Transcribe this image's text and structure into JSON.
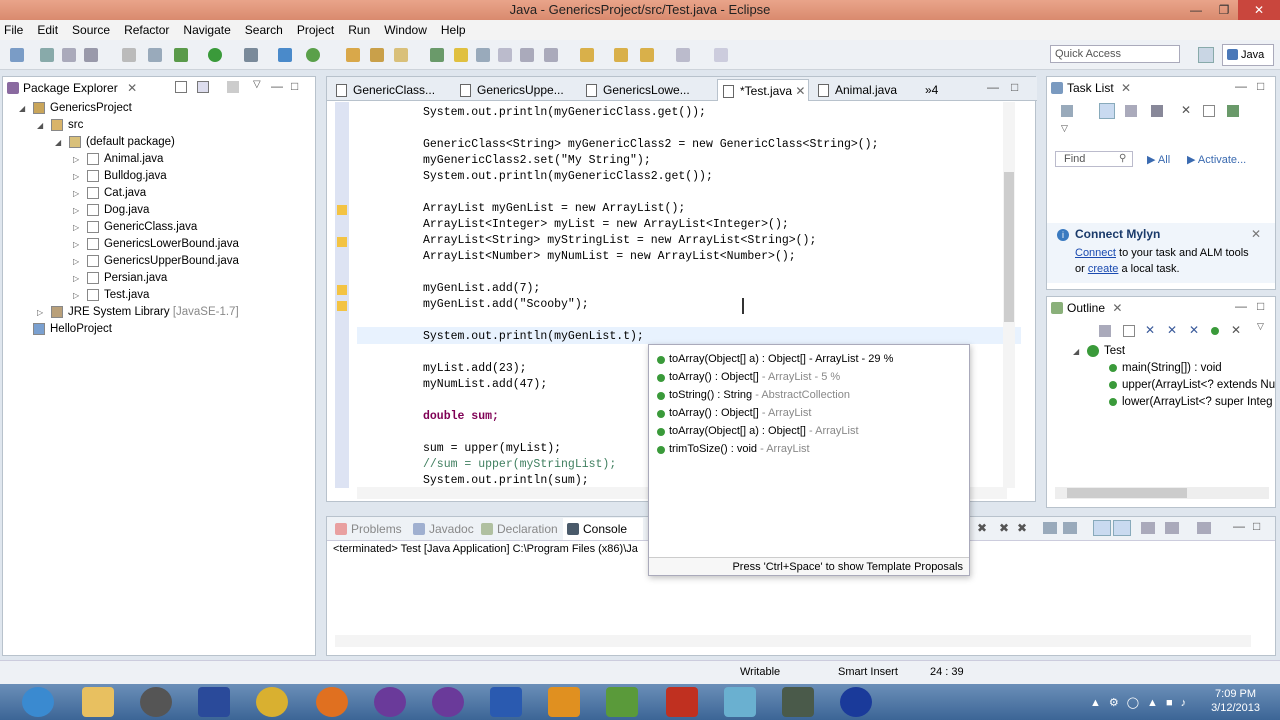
{
  "window": {
    "title": "Java - GenericsProject/src/Test.java - Eclipse"
  },
  "menu": [
    "File",
    "Edit",
    "Source",
    "Refactor",
    "Navigate",
    "Search",
    "Project",
    "Run",
    "Window",
    "Help"
  ],
  "toolbar": {
    "quick_access_placeholder": "Quick Access",
    "perspective": "Java"
  },
  "package_explorer": {
    "title": "Package Explorer",
    "items": [
      {
        "label": "GenericsProject"
      },
      {
        "label": "src"
      },
      {
        "label": "(default package)"
      },
      {
        "label": "Animal.java"
      },
      {
        "label": "Bulldog.java"
      },
      {
        "label": "Cat.java"
      },
      {
        "label": "Dog.java"
      },
      {
        "label": "GenericClass.java"
      },
      {
        "label": "GenericsLowerBound.java"
      },
      {
        "label": "GenericsUpperBound.java"
      },
      {
        "label": "Persian.java"
      },
      {
        "label": "Test.java"
      },
      {
        "label": "JRE System Library",
        "suffix": "[JavaSE-1.7]"
      },
      {
        "label": "HelloProject"
      }
    ]
  },
  "editor": {
    "tabs": [
      "GenericClass...",
      "GenericsUppe...",
      "GenericsLowe...",
      "*Test.java",
      "Animal.java"
    ],
    "overflow": "»4",
    "lines": [
      "System.out.println(myGenericClass.get());",
      "GenericClass<String> myGenericClass2 = new GenericClass<String>();",
      "myGenericClass2.set(\"My String\");",
      "System.out.println(myGenericClass2.get());",
      "ArrayList myGenList = new ArrayList();",
      "ArrayList<Integer> myList = new ArrayList<Integer>();",
      "ArrayList<String> myStringList = new ArrayList<String>();",
      "ArrayList<Number> myNumList = new ArrayList<Number>();",
      "myGenList.add(7);",
      "myGenList.add(\"Scooby\");",
      "System.out.println(myGenList.t);",
      "myList.add(23);",
      "myNumList.add(47);",
      "double sum;",
      "sum = upper(myList);",
      "//sum = upper(myStringList);",
      "System.out.println(sum);"
    ]
  },
  "autocomplete": {
    "proposals": [
      {
        "text": "toArray(Object[] a) : Object[] - ArrayList - 29 %",
        "hint": ""
      },
      {
        "text": "toArray() : Object[]",
        "hint": "- ArrayList - 5 %"
      },
      {
        "text": "toString() : String",
        "hint": "- AbstractCollection"
      },
      {
        "text": "toArray() : Object[]",
        "hint": "- ArrayList"
      },
      {
        "text": "toArray(Object[] a) : Object[]",
        "hint": "- ArrayList"
      },
      {
        "text": "trimToSize() : void",
        "hint": "- ArrayList"
      }
    ],
    "footer": "Press 'Ctrl+Space' to show Template Proposals"
  },
  "task_list": {
    "title": "Task List",
    "find_placeholder": "Find",
    "all": "All",
    "activate": "Activate...",
    "mylyn_title": "Connect Mylyn",
    "mylyn_connect": "Connect",
    "mylyn_text1": "to your task and ALM tools",
    "mylyn_or": "or",
    "mylyn_create": "create",
    "mylyn_text2": "a local task."
  },
  "outline": {
    "title": "Outline",
    "items": [
      "Test",
      "main(String[]) : void",
      "upper(ArrayList<? extends Nu",
      "lower(ArrayList<? super Integ"
    ]
  },
  "console": {
    "tabs": [
      "Problems",
      "Javadoc",
      "Declaration",
      "Console"
    ],
    "status": "<terminated> Test [Java Application] C:\\Program Files (x86)\\Ja"
  },
  "statusbar": {
    "writable": "Writable",
    "insert": "Smart Insert",
    "position": "24 : 39"
  },
  "taskbar": {
    "time": "7:09 PM",
    "date": "3/12/2013"
  }
}
